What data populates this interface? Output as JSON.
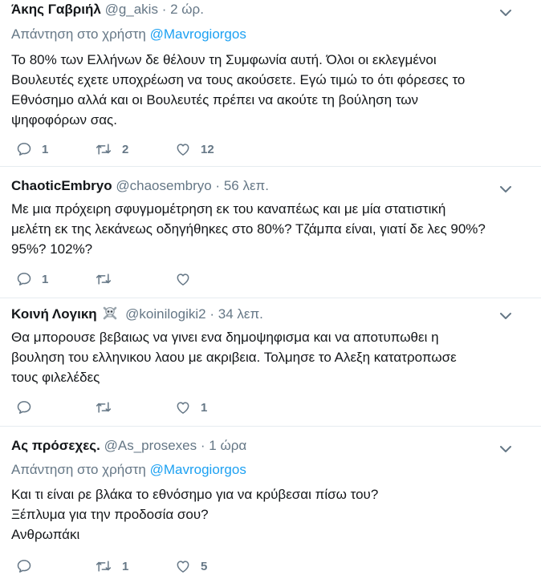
{
  "tweets": [
    {
      "name": "Άκης Γαβριήλ",
      "handle": "@g_akis",
      "dot": "·",
      "time": "2 ώρ.",
      "reply_prefix": "Απάντηση στο χρήστη",
      "reply_mention": "@Mavrogiorgos",
      "lines": [
        "Το 80% των Ελλήνων δε θέλουν τη Συμφωνία αυτή. Όλοι οι εκλεγμένοι",
        "Βουλευτές εχετε υποχρέωση να τους ακούσετε. Εγώ τιμώ το ότι φόρεσες το",
        "Εθνόσημο αλλά και οι Βουλευτές πρέπει να ακούτε τη βούληση των",
        "ψηφοφόρων σας."
      ],
      "replies": "1",
      "retweets": "2",
      "likes": "12"
    },
    {
      "name": "ChaoticEmbryo",
      "handle": "@chaosembryo",
      "dot": "·",
      "time": "56 λεπ.",
      "lines": [
        "Με μια πρόχειρη σφυγμομέτρηση εκ του καναπέως και με μία στατιστική",
        "μελέτη εκ της λεκάνεως οδηγήθηκες στο 80%? Τζάμπα είναι, γιατί δε λες 90%?",
        "95%? 102%?"
      ],
      "replies": "1",
      "retweets": "",
      "likes": ""
    },
    {
      "name": "Κοινή Λογικη",
      "handle": "@koinilogiki2",
      "dot": "·",
      "time": "34 λεπ.",
      "lines": [
        "Θα μπορουσε βεβαιως να γινει ενα δημοψηφισμα και να αποτυπωθει η",
        "βουληση του ελληνικου λαου με ακριβεια. Τολμησε το Αλεξη κατατροπωσε",
        "τους φιλελέδες"
      ],
      "replies": "",
      "retweets": "",
      "likes": "1"
    },
    {
      "name": "Ας πρόσεχες.",
      "handle": "@As_prosexes",
      "dot": "·",
      "time": "1 ώρα",
      "reply_prefix": "Απάντηση στο χρήστη",
      "reply_mention": "@Mavrogiorgos",
      "lines": [
        "Και τι είναι ρε βλάκα το εθνόσημο για να κρύβεσαι πίσω του?",
        "Ξέπλυμα για την προδοσία σου?",
        "Ανθρωπάκι"
      ],
      "replies": "",
      "retweets": "1",
      "likes": "5"
    }
  ],
  "colors": {
    "accent": "#1da1f2",
    "text": "#14171a",
    "muted": "#657786",
    "divider": "#e6ecf0"
  }
}
